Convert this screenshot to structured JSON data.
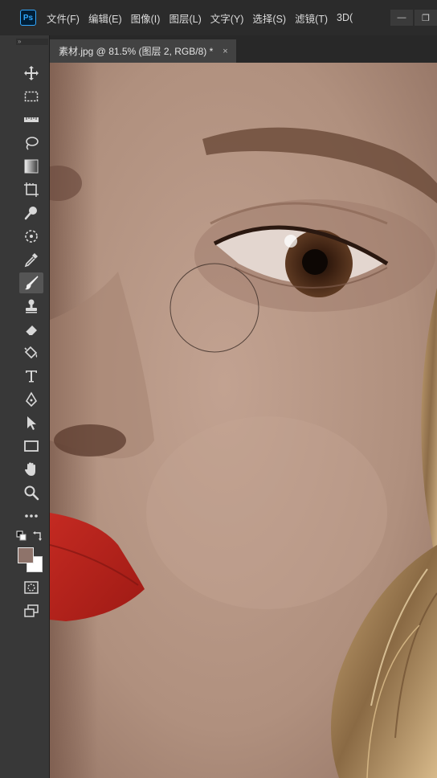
{
  "app": {
    "logo_text": "Ps"
  },
  "menu": [
    "文件(F)",
    "编辑(E)",
    "图像(I)",
    "图层(L)",
    "文字(Y)",
    "选择(S)",
    "滤镜(T)",
    "3D("
  ],
  "window_controls": {
    "minimize": "—",
    "restore": "❐"
  },
  "toolbar": {
    "collapse_glyph": "»",
    "tools": [
      {
        "name": "move-tool",
        "icon": "move-icon"
      },
      {
        "name": "marquee-tool",
        "icon": "marquee-icon"
      },
      {
        "name": "ruler-tool",
        "icon": "ruler-icon"
      },
      {
        "name": "lasso-tool",
        "icon": "lasso-icon"
      },
      {
        "name": "gradient-tool",
        "icon": "gradient-icon"
      },
      {
        "name": "crop-tool",
        "icon": "crop-icon"
      },
      {
        "name": "magic-wand-tool",
        "icon": "magic-wand-icon"
      },
      {
        "name": "healing-brush-tool",
        "icon": "healing-brush-icon"
      },
      {
        "name": "eyedropper-tool",
        "icon": "eyedropper-icon"
      },
      {
        "name": "brush-tool",
        "icon": "brush-icon",
        "active": true
      },
      {
        "name": "clone-stamp-tool",
        "icon": "stamp-icon"
      },
      {
        "name": "eraser-tool",
        "icon": "eraser-icon"
      },
      {
        "name": "paint-bucket-tool",
        "icon": "paint-bucket-icon"
      },
      {
        "name": "type-tool",
        "icon": "type-icon"
      },
      {
        "name": "pen-tool",
        "icon": "pen-icon"
      },
      {
        "name": "path-selection-tool",
        "icon": "arrow-icon"
      },
      {
        "name": "rectangle-tool",
        "icon": "rectangle-icon"
      },
      {
        "name": "hand-tool",
        "icon": "hand-icon"
      },
      {
        "name": "zoom-tool",
        "icon": "zoom-icon"
      },
      {
        "name": "more-tools",
        "icon": "ellipsis-icon"
      }
    ],
    "foreground_color": "#8e736a",
    "background_color": "#ffffff"
  },
  "document": {
    "tab_title": "素材.jpg @ 81.5% (图层 2, RGB/8) *",
    "close_glyph": "×"
  }
}
